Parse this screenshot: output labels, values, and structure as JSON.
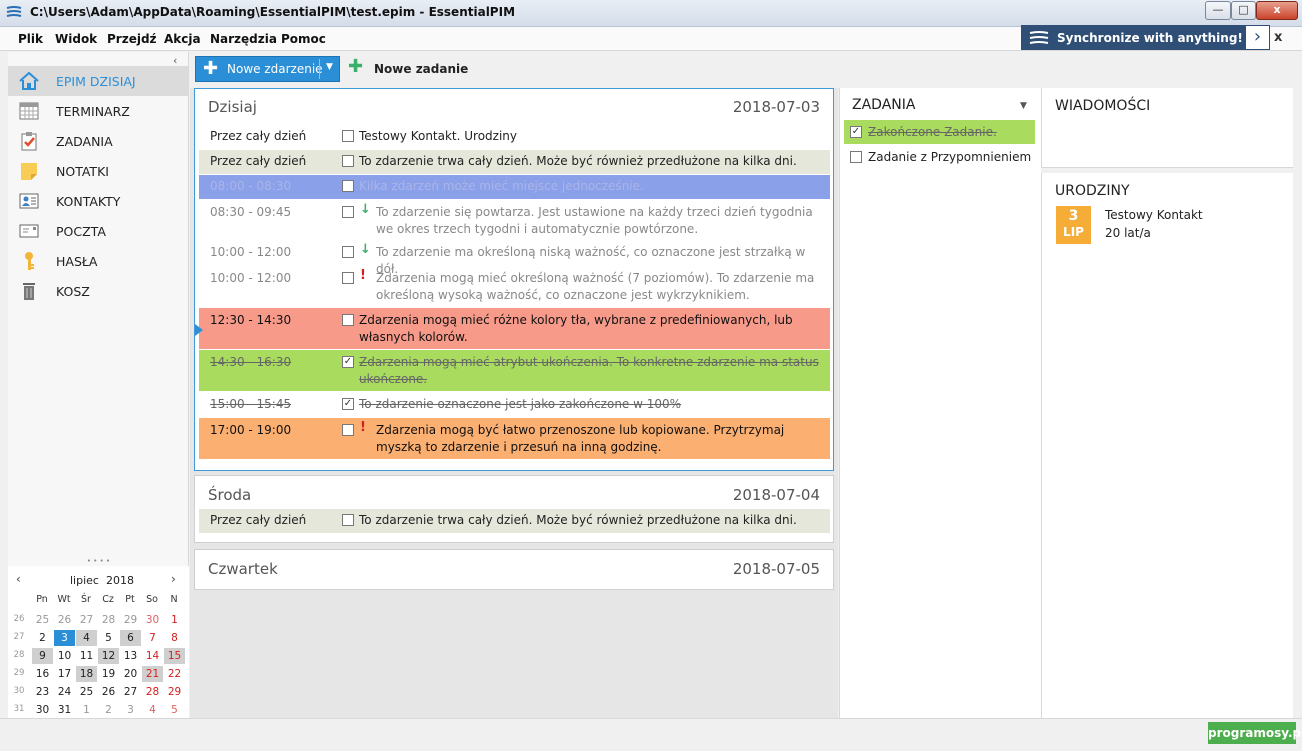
{
  "window": {
    "title": "C:\\Users\\Adam\\AppData\\Roaming\\EssentialPIM\\test.epim - EssentialPIM",
    "minimize": "—",
    "maximize": "□",
    "close": "x"
  },
  "menu": {
    "items": [
      "Plik",
      "Widok",
      "Przejdź",
      "Akcja",
      "Narzędzia",
      "Pomoc"
    ]
  },
  "banner": {
    "text": "Synchronize with anything!",
    "arrow": "›",
    "close": "x"
  },
  "sidebar": {
    "collapse": "‹",
    "items": [
      {
        "label": "EPIM DZISIAJ",
        "icon": "home-icon",
        "active": true
      },
      {
        "label": "TERMINARZ",
        "icon": "calendar-icon"
      },
      {
        "label": "ZADANIA",
        "icon": "tasks-icon"
      },
      {
        "label": "NOTATKI",
        "icon": "notes-icon"
      },
      {
        "label": "KONTAKTY",
        "icon": "contacts-icon"
      },
      {
        "label": "POCZTA",
        "icon": "mail-icon"
      },
      {
        "label": "HASŁA",
        "icon": "key-icon"
      },
      {
        "label": "KOSZ",
        "icon": "trash-icon"
      }
    ],
    "splitter": "• • • •"
  },
  "mini_calendar": {
    "prev": "‹",
    "next": "›",
    "month": "lipiec",
    "year": "2018",
    "weekdays": [
      "Pn",
      "Wt",
      "Śr",
      "Cz",
      "Pt",
      "So",
      "N"
    ],
    "weeks": [
      {
        "num": "26",
        "days": [
          "25",
          "26",
          "27",
          "28",
          "29",
          "30",
          "1"
        ]
      },
      {
        "num": "27",
        "days": [
          "2",
          "3",
          "4",
          "5",
          "6",
          "7",
          "8"
        ]
      },
      {
        "num": "28",
        "days": [
          "9",
          "10",
          "11",
          "12",
          "13",
          "14",
          "15"
        ]
      },
      {
        "num": "29",
        "days": [
          "16",
          "17",
          "18",
          "19",
          "20",
          "21",
          "22"
        ]
      },
      {
        "num": "30",
        "days": [
          "23",
          "24",
          "25",
          "26",
          "27",
          "28",
          "29"
        ]
      },
      {
        "num": "31",
        "days": [
          "30",
          "31",
          "1",
          "2",
          "3",
          "4",
          "5"
        ]
      }
    ],
    "today": "3"
  },
  "toolbar": {
    "new_event": "Nowe zdarzenie",
    "new_task": "Nowe zadanie",
    "plus": "✚",
    "dropdown": "▼"
  },
  "days": [
    {
      "name": "Dzisiaj",
      "date": "2018-07-03",
      "events": [
        {
          "time": "Przez cały dzień",
          "text": "Testowy Kontakt. Urodziny",
          "checked": false,
          "priority": ""
        },
        {
          "time": "Przez cały dzień",
          "text": "To zdarzenie trwa cały dzień. Może być również przedłużone na kilka dni.",
          "checked": false,
          "priority": ""
        },
        {
          "time": "08:00 - 08:30",
          "text": "Kilka zdarzeń może mieć miejsce jednocześnie.",
          "checked": false,
          "priority": ""
        },
        {
          "time": "08:30 - 09:45",
          "text": "To zdarzenie się powtarza. Jest ustawione na każdy trzeci dzień tygodnia we okres trzech tygodni i automatycznie powtórzone.",
          "checked": false,
          "priority": "↓"
        },
        {
          "time": "10:00 - 12:00",
          "text": "To zdarzenie ma określoną niską ważność, co oznaczone jest strzałką w dół.",
          "checked": false,
          "priority": "↓"
        },
        {
          "time": "10:00 - 12:00",
          "text": "Zdarzenia mogą mieć określoną ważność (7 poziomów). To zdarzenie ma określoną wysoką ważność, co oznaczone jest wykrzyknikiem.",
          "checked": false,
          "priority": "!"
        },
        {
          "time": "12:30 - 14:30",
          "text": "Zdarzenia mogą mieć różne kolory tła, wybrane z predefiniowanych, lub własnych kolorów.",
          "checked": false,
          "priority": ""
        },
        {
          "time": "14:30 - 16:30",
          "text": "Zdarzenia mogą mieć atrybut ukończenia. To konkretne zdarzenie ma status ukończone.",
          "checked": true,
          "priority": ""
        },
        {
          "time": "15:00 - 15:45",
          "text": "To zdarzenie oznaczone jest jako zakończone w 100%",
          "checked": true,
          "priority": ""
        },
        {
          "time": "17:00 - 19:00",
          "text": "Zdarzenia mogą być łatwo przenoszone lub kopiowane. Przytrzymaj myszką to zdarzenie i przesuń na inną godzinę.",
          "checked": false,
          "priority": "!"
        }
      ]
    },
    {
      "name": "Środa",
      "date": "2018-07-04",
      "events": [
        {
          "time": "Przez cały dzień",
          "text": "To zdarzenie trwa cały dzień. Może być również przedłużone na kilka dni.",
          "checked": false,
          "priority": ""
        }
      ]
    },
    {
      "name": "Czwartek",
      "date": "2018-07-05",
      "events": []
    }
  ],
  "tasks": {
    "header": "ZADANIA",
    "dropdown": "▼",
    "items": [
      {
        "label": "Zakończone Zadanie.",
        "checked": true
      },
      {
        "label": "Zadanie z Przypomnieniem",
        "checked": false
      }
    ]
  },
  "messages": {
    "header": "WIADOMOŚCI"
  },
  "birthdays": {
    "header": "URODZINY",
    "day": "3",
    "month": "LIP",
    "name": "Testowy Kontakt",
    "age": "20 lat/a"
  },
  "watermark": "programosy.pl",
  "check_mark": "✓",
  "colors": {
    "accent": "#2b8fd8",
    "banner": "#2f4f76",
    "event_allday": "#e6e7db",
    "event_blue": "#8aa0e8",
    "event_red": "#f79a8a",
    "event_green": "#a9dc5e",
    "event_orange": "#fbb072",
    "birthday": "#f6ad37",
    "priority_low": "#3bb06b",
    "priority_high": "#d42020"
  }
}
